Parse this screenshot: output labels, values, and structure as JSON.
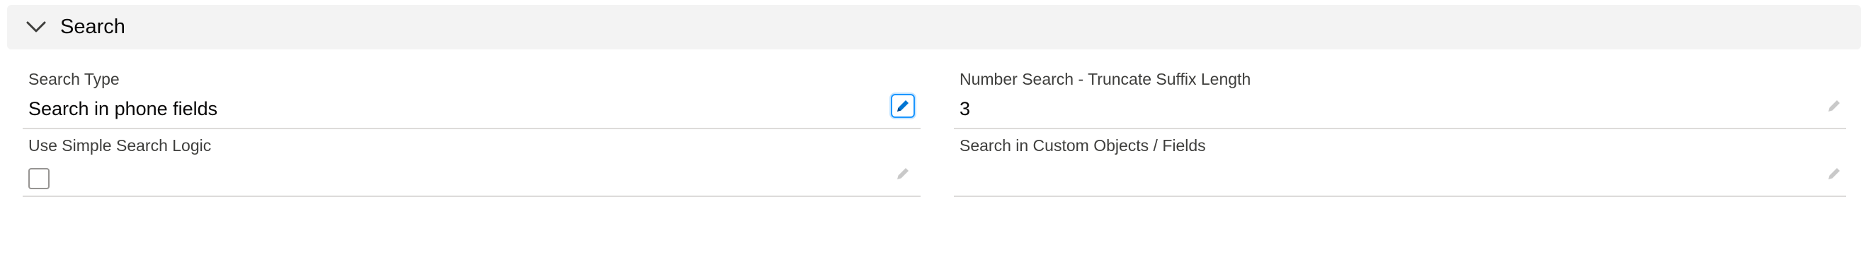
{
  "section": {
    "title": "Search",
    "chevron_icon": "chevron-down-icon"
  },
  "fields": {
    "search_type": {
      "label": "Search Type",
      "value": "Search in phone fields",
      "edit_icon": "pencil-icon"
    },
    "truncate_suffix": {
      "label": "Number Search - Truncate Suffix Length",
      "value": "3",
      "edit_icon": "pencil-icon"
    },
    "simple_logic": {
      "label": "Use Simple Search Logic",
      "checked": false,
      "edit_icon": "pencil-icon"
    },
    "custom_objects": {
      "label": "Search in Custom Objects / Fields",
      "value": "",
      "edit_icon": "pencil-icon"
    }
  },
  "colors": {
    "header_bg": "#f3f3f3",
    "label": "#3e3e3c",
    "value": "#080707",
    "active_edit": "#0176d3",
    "inactive_edit": "#c9c9c9",
    "divider": "#dddbda"
  }
}
